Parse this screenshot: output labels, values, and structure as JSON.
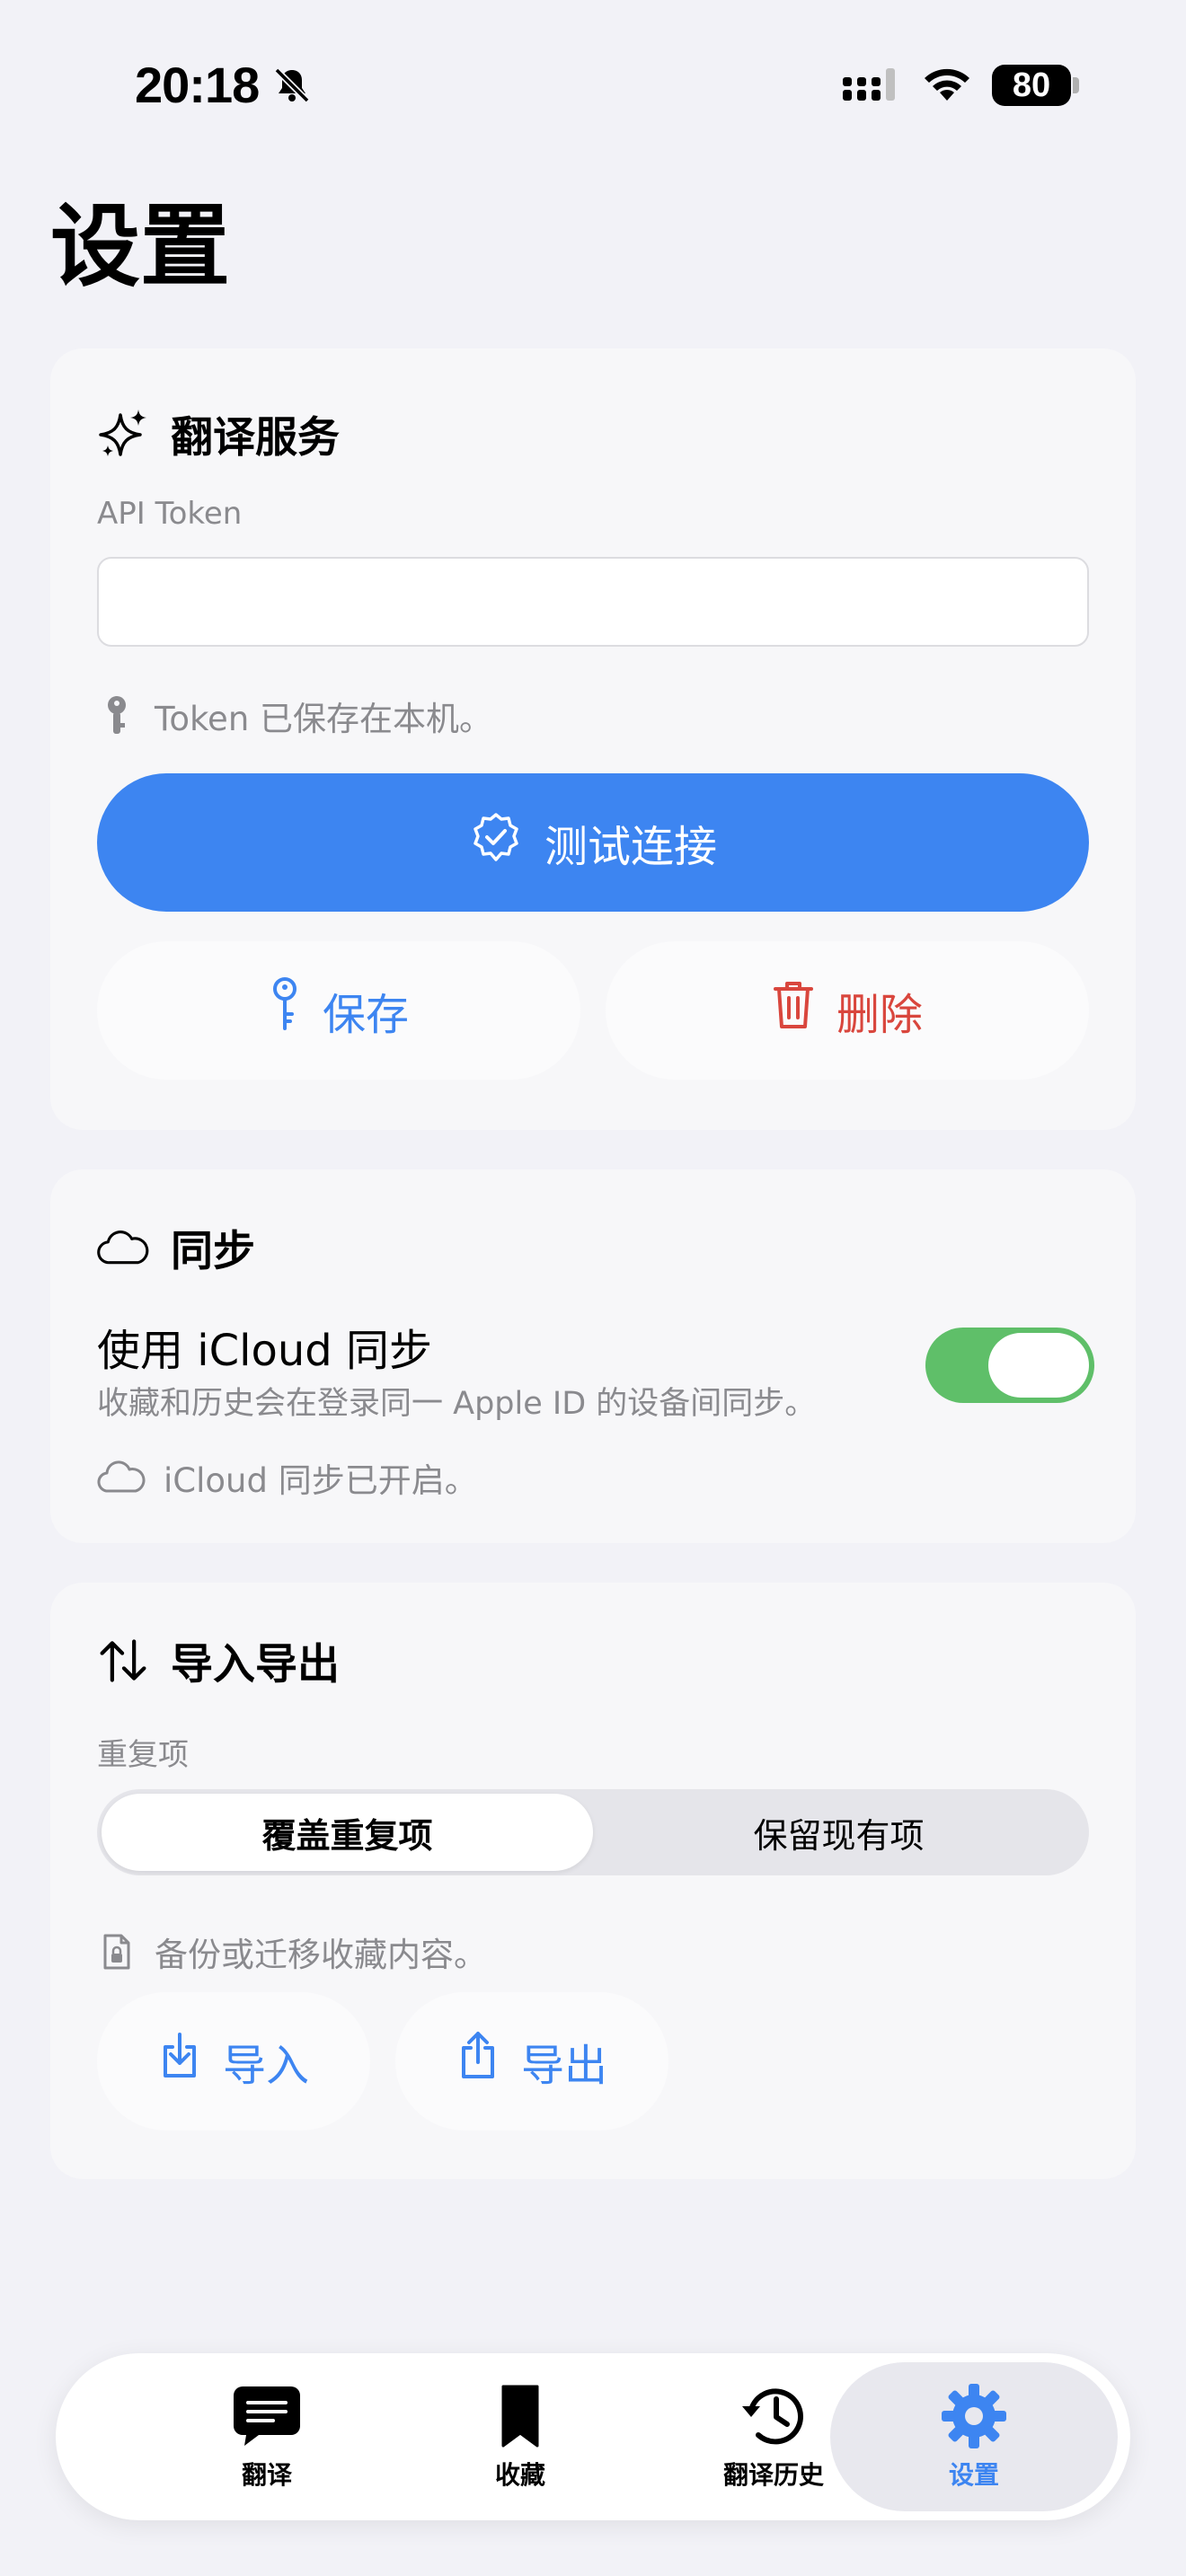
{
  "status_bar": {
    "time": "20:18",
    "battery": "80"
  },
  "page": {
    "title": "设置"
  },
  "translation": {
    "title": "翻译服务",
    "token_label": "API Token",
    "token_value": "",
    "token_hint": "Token 已保存在本机。",
    "test_button": "测试连接",
    "save_button": "保存",
    "delete_button": "删除"
  },
  "sync": {
    "title": "同步",
    "toggle_label": "使用 iCloud 同步",
    "toggle_description": "收藏和历史会在登录同一 Apple ID 的设备间同步。",
    "toggle_on": true,
    "status": "iCloud 同步已开启。"
  },
  "import_export": {
    "title": "导入导出",
    "duplicates_label": "重复项",
    "segments": [
      "覆盖重复项",
      "保留现有项"
    ],
    "selected_segment": "覆盖重复项",
    "hint": "备份或迁移收藏内容。",
    "import_button": "导入",
    "export_button": "导出"
  },
  "tabs": [
    {
      "label": "翻译",
      "icon": "chat-bubble-icon"
    },
    {
      "label": "收藏",
      "icon": "bookmark-icon"
    },
    {
      "label": "翻译历史",
      "icon": "history-clock-icon"
    },
    {
      "label": "设置",
      "icon": "gear-icon",
      "active": true
    }
  ],
  "colors": {
    "accent": "#3d85f1",
    "destructive": "#d9463d",
    "toggle_on": "#5fbf69",
    "background": "#f2f2f7"
  }
}
